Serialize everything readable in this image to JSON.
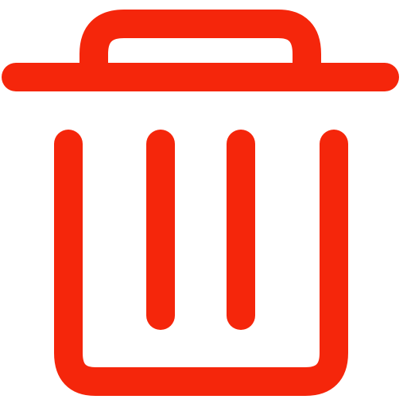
{
  "icon": {
    "name": "trash-icon",
    "color": "#F5260B",
    "background": "#FFFFFF"
  }
}
